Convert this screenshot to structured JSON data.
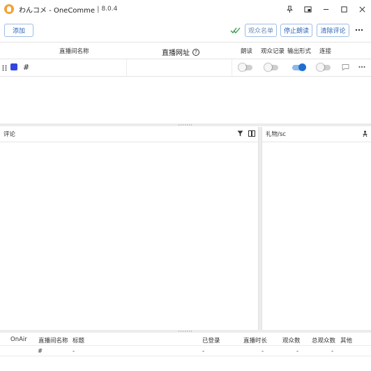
{
  "window": {
    "app_name": "わんコメ - OneComme",
    "separator": "|",
    "version": "8.0.4"
  },
  "toolbar": {
    "add_label": "添加",
    "viewer_list_label": "观众名单",
    "stop_reading_label": "停止朗读",
    "clear_comments_label": "清除评论"
  },
  "rooms_table": {
    "headers": {
      "name": "直播间名称",
      "url": "直播网址",
      "read": "朗读",
      "viewer_log": "观众记录",
      "output_format": "输出形式",
      "connect": "连接"
    },
    "rows": [
      {
        "color": "#3346e0",
        "name": "#",
        "url": "",
        "read_enabled": false,
        "viewer_log_enabled": false,
        "output_format_enabled": true,
        "connect_enabled": false
      }
    ]
  },
  "comments_panel": {
    "title": "评论"
  },
  "gifts_panel": {
    "title": "礼物/sc"
  },
  "stats_table": {
    "headers": {
      "onair": "OnAir",
      "room_name": "直播间名称",
      "title": "标题",
      "logged_in": "已登录",
      "duration": "直播时长",
      "viewers": "观众数",
      "total_viewers": "总观众数",
      "other": "其他"
    },
    "rows": [
      {
        "onair": "",
        "room_name": "#",
        "title": "-",
        "logged_in": "-",
        "duration": "-",
        "viewers": "-",
        "total_viewers": "-",
        "other": ""
      }
    ]
  },
  "icons": {
    "app": "onecomme-app-icon",
    "pin": "pin-icon",
    "picture_in_picture": "picture-in-picture-icon",
    "minimize": "minimize-icon",
    "maximize": "maximize-icon",
    "close": "close-icon",
    "connected_check": "double-check-icon",
    "more": "more-horizontal-icon",
    "help": "help-circle-icon",
    "drag": "drag-handle-icon",
    "chat": "chat-bubble-icon",
    "filter": "filter-icon",
    "columns": "columns-icon",
    "person": "person-icon"
  },
  "colors": {
    "accent": "#2a64b8",
    "toggle_on": "#1f6fd0",
    "check_green": "#2e9b4a",
    "app_icon": "#f2a23a"
  }
}
